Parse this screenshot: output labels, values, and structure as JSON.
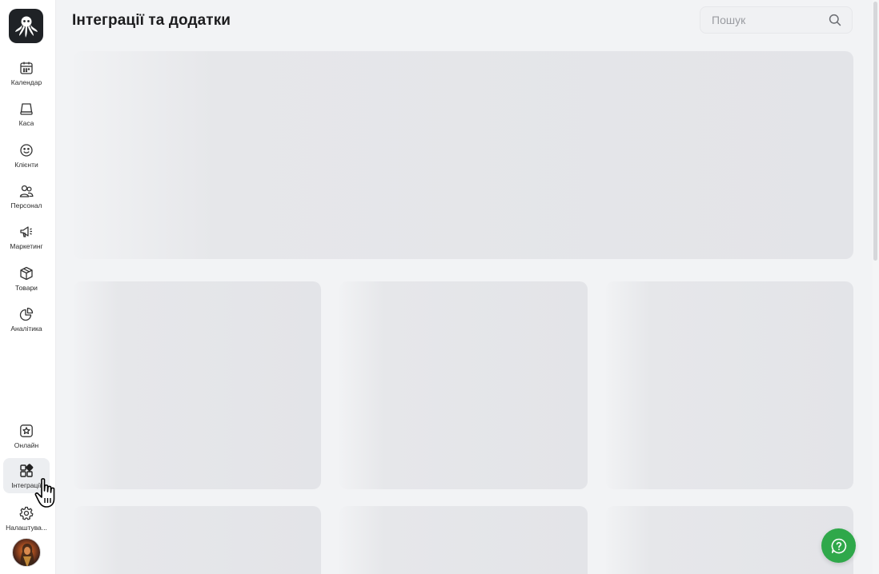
{
  "header": {
    "title": "Інтеграції та додатки",
    "search_placeholder": "Пошук"
  },
  "sidebar": {
    "logo": "octopus-logo-icon",
    "items": [
      {
        "label": "Календар",
        "icon": "calendar-icon"
      },
      {
        "label": "Каса",
        "icon": "cash-register-icon"
      },
      {
        "label": "Клієнти",
        "icon": "smile-icon"
      },
      {
        "label": "Персонал",
        "icon": "users-icon"
      },
      {
        "label": "Маркетинг",
        "icon": "megaphone-icon"
      },
      {
        "label": "Товари",
        "icon": "box-icon"
      },
      {
        "label": "Аналітика",
        "icon": "pie-chart-icon"
      }
    ],
    "bottom_items": [
      {
        "label": "Онлайн",
        "icon": "star-square-icon"
      },
      {
        "label": "Інтеграції",
        "icon": "apps-icon",
        "active": true
      },
      {
        "label": "Налаштува...",
        "icon": "gear-icon"
      }
    ]
  },
  "colors": {
    "help_button": "#2fa84a",
    "page_background": "#f2f3f5",
    "skeleton": "#e4e5e8"
  }
}
